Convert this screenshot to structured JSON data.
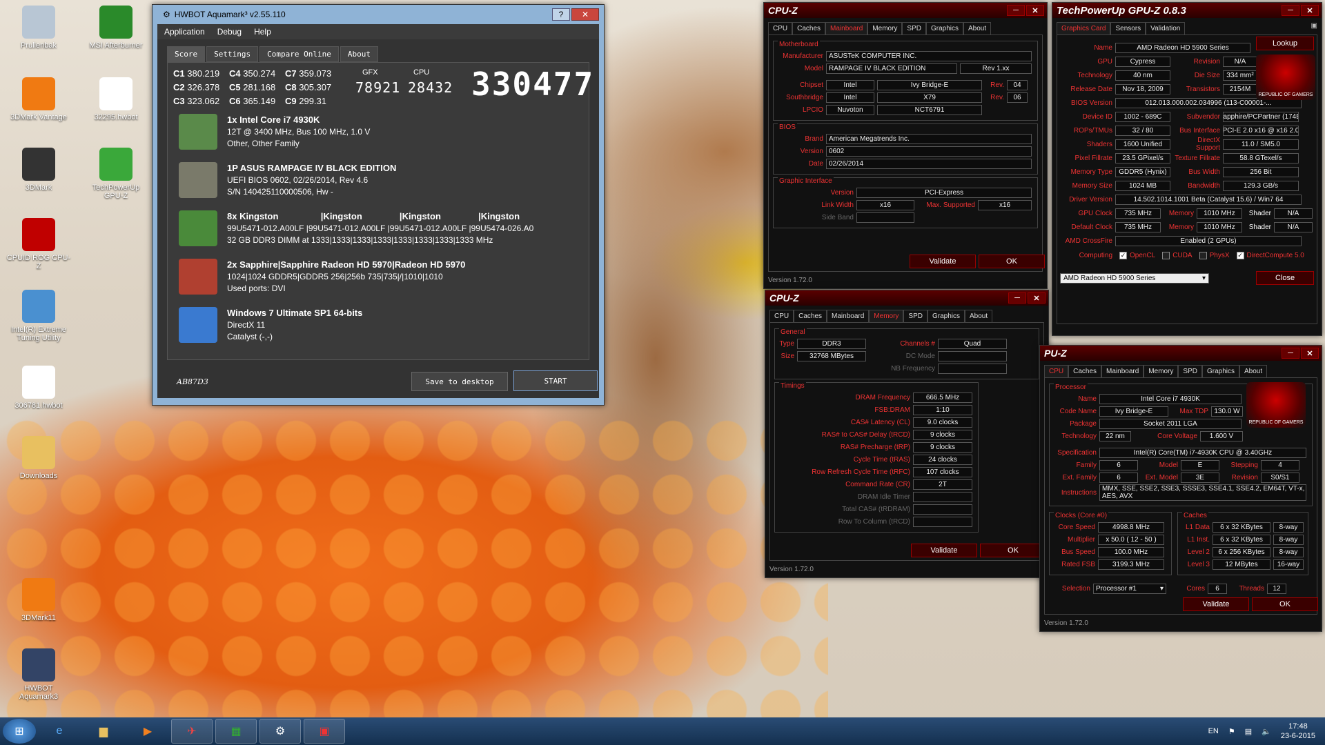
{
  "desktop": {
    "icons": [
      {
        "label": "Prullenbak",
        "icon": "recycle-bin-icon",
        "color": "#b8c6d4"
      },
      {
        "label": "MSI Afterburner",
        "icon": "afterburner-icon",
        "color": "#2a8a2a"
      },
      {
        "label": "3DMark Vantage",
        "icon": "3dmark-vantage-icon",
        "color": "#f07a12"
      },
      {
        "label": "32295.hwbot",
        "icon": "file-icon",
        "color": "#ffffff"
      },
      {
        "label": "3DMark",
        "icon": "3dmark-icon",
        "color": "#333333"
      },
      {
        "label": "TechPowerUp GPU-Z",
        "icon": "gpuz-icon",
        "color": "#3aa83a"
      },
      {
        "label": "CPUID ROG CPU-Z",
        "icon": "rog-cpuz-icon",
        "color": "#c00000"
      },
      {
        "label": "Intel(R) Extreme Tuning Utility",
        "icon": "xtu-icon",
        "color": "#4a90d0"
      },
      {
        "label": "306781.hwbot",
        "icon": "file-icon",
        "color": "#ffffff"
      },
      {
        "label": "Downloads",
        "icon": "folder-icon",
        "color": "#e8c060"
      },
      {
        "label": "3DMark11",
        "icon": "3dmark11-icon",
        "color": "#f07a12"
      },
      {
        "label": "HWBOT Aquamark3",
        "icon": "aquamark-icon",
        "color": "#334466"
      }
    ]
  },
  "aquamark": {
    "title": "HWBOT Aquamark³ v2.55.110",
    "menu": [
      "Application",
      "Debug",
      "Help"
    ],
    "tabs": [
      "Score",
      "Settings",
      "Compare Online",
      "About"
    ],
    "scores": [
      {
        "k": "C1",
        "v": "380.219"
      },
      {
        "k": "C4",
        "v": "350.274"
      },
      {
        "k": "C7",
        "v": "359.073"
      },
      {
        "k": "C2",
        "v": "326.378"
      },
      {
        "k": "C5",
        "v": "281.168"
      },
      {
        "k": "C8",
        "v": "305.307"
      },
      {
        "k": "C3",
        "v": "323.062"
      },
      {
        "k": "C6",
        "v": "365.149"
      },
      {
        "k": "C9",
        "v": "299.31"
      }
    ],
    "gfx_label": "GFX",
    "gfx_value": "78921",
    "cpu_label": "CPU",
    "cpu_value": "28432",
    "total": "330477",
    "hardware": [
      {
        "icon": "cpu-chip-icon",
        "title": "1x Intel Core i7 4930K",
        "lines": [
          "12T @ 3400 MHz, Bus 100 MHz, 1.0 V",
          "Other, Other Family"
        ]
      },
      {
        "icon": "motherboard-icon",
        "title": "1P ASUS RAMPAGE IV BLACK EDITION",
        "lines": [
          "UEFI BIOS 0602, 02/26/2014, Rev 4.6",
          "S/N 140425110000506, Hw -"
        ]
      },
      {
        "icon": "memory-module-icon",
        "title": "8x Kingston                 |Kingston               |Kingston               |Kingston",
        "lines": [
          "99U5471-012.A00LF   |99U5471-012.A00LF   |99U5471-012.A00LF   |99U5474-026.A0",
          "32 GB DDR3 DIMM at 1333|1333|1333|1333|1333|1333|1333|1333 MHz"
        ]
      },
      {
        "icon": "graphics-card-icon",
        "title": "2x Sapphire|Sapphire Radeon HD 5970|Radeon HD 5970",
        "lines": [
          "1024|1024 GDDR5|GDDR5 256|256b 735|735|/|1010|1010",
          "Used ports: DVI"
        ]
      },
      {
        "icon": "windows-logo-icon",
        "title": "Windows 7 Ultimate SP1 64-bits",
        "lines": [
          "DirectX 11",
          "Catalyst (-,-)"
        ]
      }
    ],
    "code": "AB87D3",
    "save_label": "Save to desktop",
    "start_label": "START"
  },
  "cpuz_mb": {
    "title": "CPU-Z",
    "tabs": [
      "CPU",
      "Caches",
      "Mainboard",
      "Memory",
      "SPD",
      "Graphics",
      "About"
    ],
    "motherboard": {
      "title": "Motherboard",
      "manufacturer_label": "Manufacturer",
      "manufacturer": "ASUSTeK COMPUTER INC.",
      "model_label": "Model",
      "model": "RAMPAGE IV BLACK EDITION",
      "model_rev": "Rev 1.xx",
      "chipset_label": "Chipset",
      "chipset_vendor": "Intel",
      "chipset": "Ivy Bridge-E",
      "chipset_rev_label": "Rev.",
      "chipset_rev": "04",
      "southbridge_label": "Southbridge",
      "sb_vendor": "Intel",
      "sb": "X79",
      "sb_rev_label": "Rev.",
      "sb_rev": "06",
      "lpcio_label": "LPCIO",
      "lpcio_vendor": "Nuvoton",
      "lpcio": "NCT6791"
    },
    "bios": {
      "title": "BIOS",
      "brand_label": "Brand",
      "brand": "American Megatrends Inc.",
      "version_label": "Version",
      "version": "0602",
      "date_label": "Date",
      "date": "02/26/2014"
    },
    "graphic": {
      "title": "Graphic Interface",
      "version_label": "Version",
      "version": "PCI-Express",
      "link_label": "Link Width",
      "link": "x16",
      "max_label": "Max. Supported",
      "max": "x16",
      "side_label": "Side Band"
    },
    "validate": "Validate",
    "ok": "OK",
    "ver": "Version 1.72.0"
  },
  "cpuz_mem": {
    "title": "CPU-Z",
    "tabs": [
      "CPU",
      "Caches",
      "Mainboard",
      "Memory",
      "SPD",
      "Graphics",
      "About"
    ],
    "general": {
      "title": "General",
      "type_label": "Type",
      "type": "DDR3",
      "channels_label": "Channels #",
      "channels": "Quad",
      "size_label": "Size",
      "size": "32768 MBytes",
      "dc_label": "DC Mode",
      "nb_label": "NB Frequency"
    },
    "timings": {
      "title": "Timings",
      "rows": [
        {
          "l": "DRAM Frequency",
          "v": "666.5 MHz"
        },
        {
          "l": "FSB:DRAM",
          "v": "1:10"
        },
        {
          "l": "CAS# Latency (CL)",
          "v": "9.0 clocks"
        },
        {
          "l": "RAS# to CAS# Delay (tRCD)",
          "v": "9 clocks"
        },
        {
          "l": "RAS# Precharge (tRP)",
          "v": "9 clocks"
        },
        {
          "l": "Cycle Time (tRAS)",
          "v": "24 clocks"
        },
        {
          "l": "Row Refresh Cycle Time (tRFC)",
          "v": "107 clocks"
        },
        {
          "l": "Command Rate (CR)",
          "v": "2T"
        },
        {
          "l": "DRAM Idle Timer",
          "v": ""
        },
        {
          "l": "Total CAS# (tRDRAM)",
          "v": ""
        },
        {
          "l": "Row To Column (tRCD)",
          "v": ""
        }
      ]
    },
    "validate": "Validate",
    "ok": "OK",
    "ver": "Version 1.72.0"
  },
  "gpuz": {
    "title": "TechPowerUp GPU-Z 0.8.3",
    "tabs": [
      "Graphics Card",
      "Sensors",
      "Validation"
    ],
    "lookup": "Lookup",
    "rows": [
      {
        "l": "Name",
        "v": "AMD Radeon HD 5900 Series"
      },
      {
        "l": "GPU",
        "v": "Cypress",
        "l2": "Revision",
        "v2": "N/A"
      },
      {
        "l": "Technology",
        "v": "40 nm",
        "l2": "Die Size",
        "v2": "334 mm²"
      },
      {
        "l": "Release Date",
        "v": "Nov 18, 2009",
        "l2": "Transistors",
        "v2": "2154M"
      },
      {
        "l": "BIOS Version",
        "v": "012.013.000.002.034996 (113-C00001-..."
      },
      {
        "l": "Device ID",
        "v": "1002 - 689C",
        "l2": "Subvendor",
        "v2": "Sapphire/PCPartner (174B)"
      },
      {
        "l": "ROPs/TMUs",
        "v": "32 / 80",
        "l2": "Bus Interface",
        "v2": "PCI-E 2.0 x16 @ x16 2.0"
      },
      {
        "l": "Shaders",
        "v": "1600 Unified",
        "l2": "DirectX Support",
        "v2": "11.0 / SM5.0"
      },
      {
        "l": "Pixel Fillrate",
        "v": "23.5 GPixel/s",
        "l2": "Texture Fillrate",
        "v2": "58.8 GTexel/s"
      },
      {
        "l": "Memory Type",
        "v": "GDDR5 (Hynix)",
        "l2": "Bus Width",
        "v2": "256 Bit"
      },
      {
        "l": "Memory Size",
        "v": "1024 MB",
        "l2": "Bandwidth",
        "v2": "129.3 GB/s"
      },
      {
        "l": "Driver Version",
        "v": "14.502.1014.1001 Beta (Catalyst 15.6) / Win7 64"
      },
      {
        "l": "GPU Clock",
        "v": "735 MHz",
        "l2": "Memory",
        "v2": "1010 MHz",
        "l3": "Shader",
        "v3": "N/A"
      },
      {
        "l": "Default Clock",
        "v": "735 MHz",
        "l2": "Memory",
        "v2": "1010 MHz",
        "l3": "Shader",
        "v3": "N/A"
      },
      {
        "l": "AMD CrossFire",
        "v": "Enabled (2 GPUs)"
      }
    ],
    "computing_label": "Computing",
    "computing": [
      {
        "n": "OpenCL",
        "c": true
      },
      {
        "n": "CUDA",
        "c": false
      },
      {
        "n": "PhysX",
        "c": false
      },
      {
        "n": "DirectCompute 5.0",
        "c": true
      }
    ],
    "select": "AMD Radeon HD 5900 Series",
    "close": "Close"
  },
  "cpuz_cpu": {
    "title": "PU-Z",
    "tabs": [
      "CPU",
      "Caches",
      "Mainboard",
      "Memory",
      "SPD",
      "Graphics",
      "About"
    ],
    "proc_title": "Processor",
    "name_label": "Name",
    "name": "Intel Core i7 4930K",
    "codename_label": "Code Name",
    "codename": "Ivy Bridge-E",
    "tdp_label": "Max TDP",
    "tdp": "130.0 W",
    "package_label": "Package",
    "package": "Socket 2011 LGA",
    "tech_label": "Technology",
    "tech": "22 nm",
    "voltage_label": "Core Voltage",
    "voltage": "1.600 V",
    "spec_label": "Specification",
    "spec": "Intel(R) Core(TM) i7-4930K CPU @ 3.40GHz",
    "family_label": "Family",
    "family": "6",
    "model_label": "Model",
    "model": "E",
    "stepping_label": "Stepping",
    "stepping": "4",
    "extfam_label": "Ext. Family",
    "extfam": "6",
    "extmodel_label": "Ext. Model",
    "extmodel": "3E",
    "rev_label": "Revision",
    "rev": "S0/S1",
    "instr_label": "Instructions",
    "instr": "MMX, SSE, SSE2, SSE3, SSSE3, SSE4.1, SSE4.2, EM64T, VT-x, AES, AVX",
    "clocks_title": "Clocks (Core #0)",
    "clocks": [
      {
        "l": "Core Speed",
        "v": "4998.8 MHz"
      },
      {
        "l": "Multiplier",
        "v": "x 50.0 ( 12 - 50 )"
      },
      {
        "l": "Bus Speed",
        "v": "100.0 MHz"
      },
      {
        "l": "Rated FSB",
        "v": "3199.3 MHz"
      }
    ],
    "caches_title": "Caches",
    "caches": [
      {
        "l": "L1 Data",
        "v": "6 x 32 KBytes",
        "w": "8-way"
      },
      {
        "l": "L1 Inst.",
        "v": "6 x 32 KBytes",
        "w": "8-way"
      },
      {
        "l": "Level 2",
        "v": "6 x 256 KBytes",
        "w": "8-way"
      },
      {
        "l": "Level 3",
        "v": "12 MBytes",
        "w": "16-way"
      }
    ],
    "selection_label": "Selection",
    "selection": "Processor #1",
    "cores_label": "Cores",
    "cores": "6",
    "threads_label": "Threads",
    "threads": "12",
    "validate": "Validate",
    "ok": "OK",
    "ver": "Version 1.72.0"
  },
  "rog_text": "REPUBLIC OF GAMERS",
  "taskbar": {
    "lang": "EN",
    "time": "17:48",
    "date": "23-6-2015"
  }
}
